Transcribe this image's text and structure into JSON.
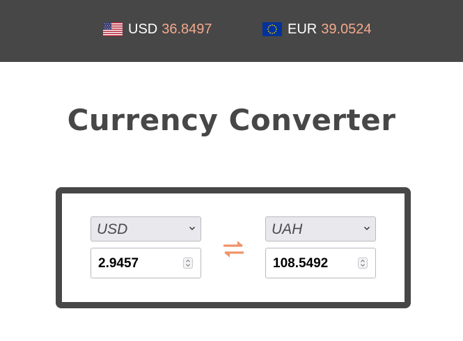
{
  "rates": {
    "usd": {
      "code": "USD",
      "value": "36.8497",
      "flag_icon": "us-flag-icon"
    },
    "eur": {
      "code": "EUR",
      "value": "39.0524",
      "flag_icon": "eu-flag-icon"
    }
  },
  "title": "Currency Converter",
  "converter": {
    "from": {
      "currency": "USD",
      "amount": "2.9457"
    },
    "to": {
      "currency": "UAH",
      "amount": "108.5492"
    },
    "swap_icon": "swap-arrows-icon"
  },
  "colors": {
    "topbar_bg": "#474747",
    "accent": "#f4a98c",
    "swap": "#f0936b",
    "title": "#474747"
  }
}
